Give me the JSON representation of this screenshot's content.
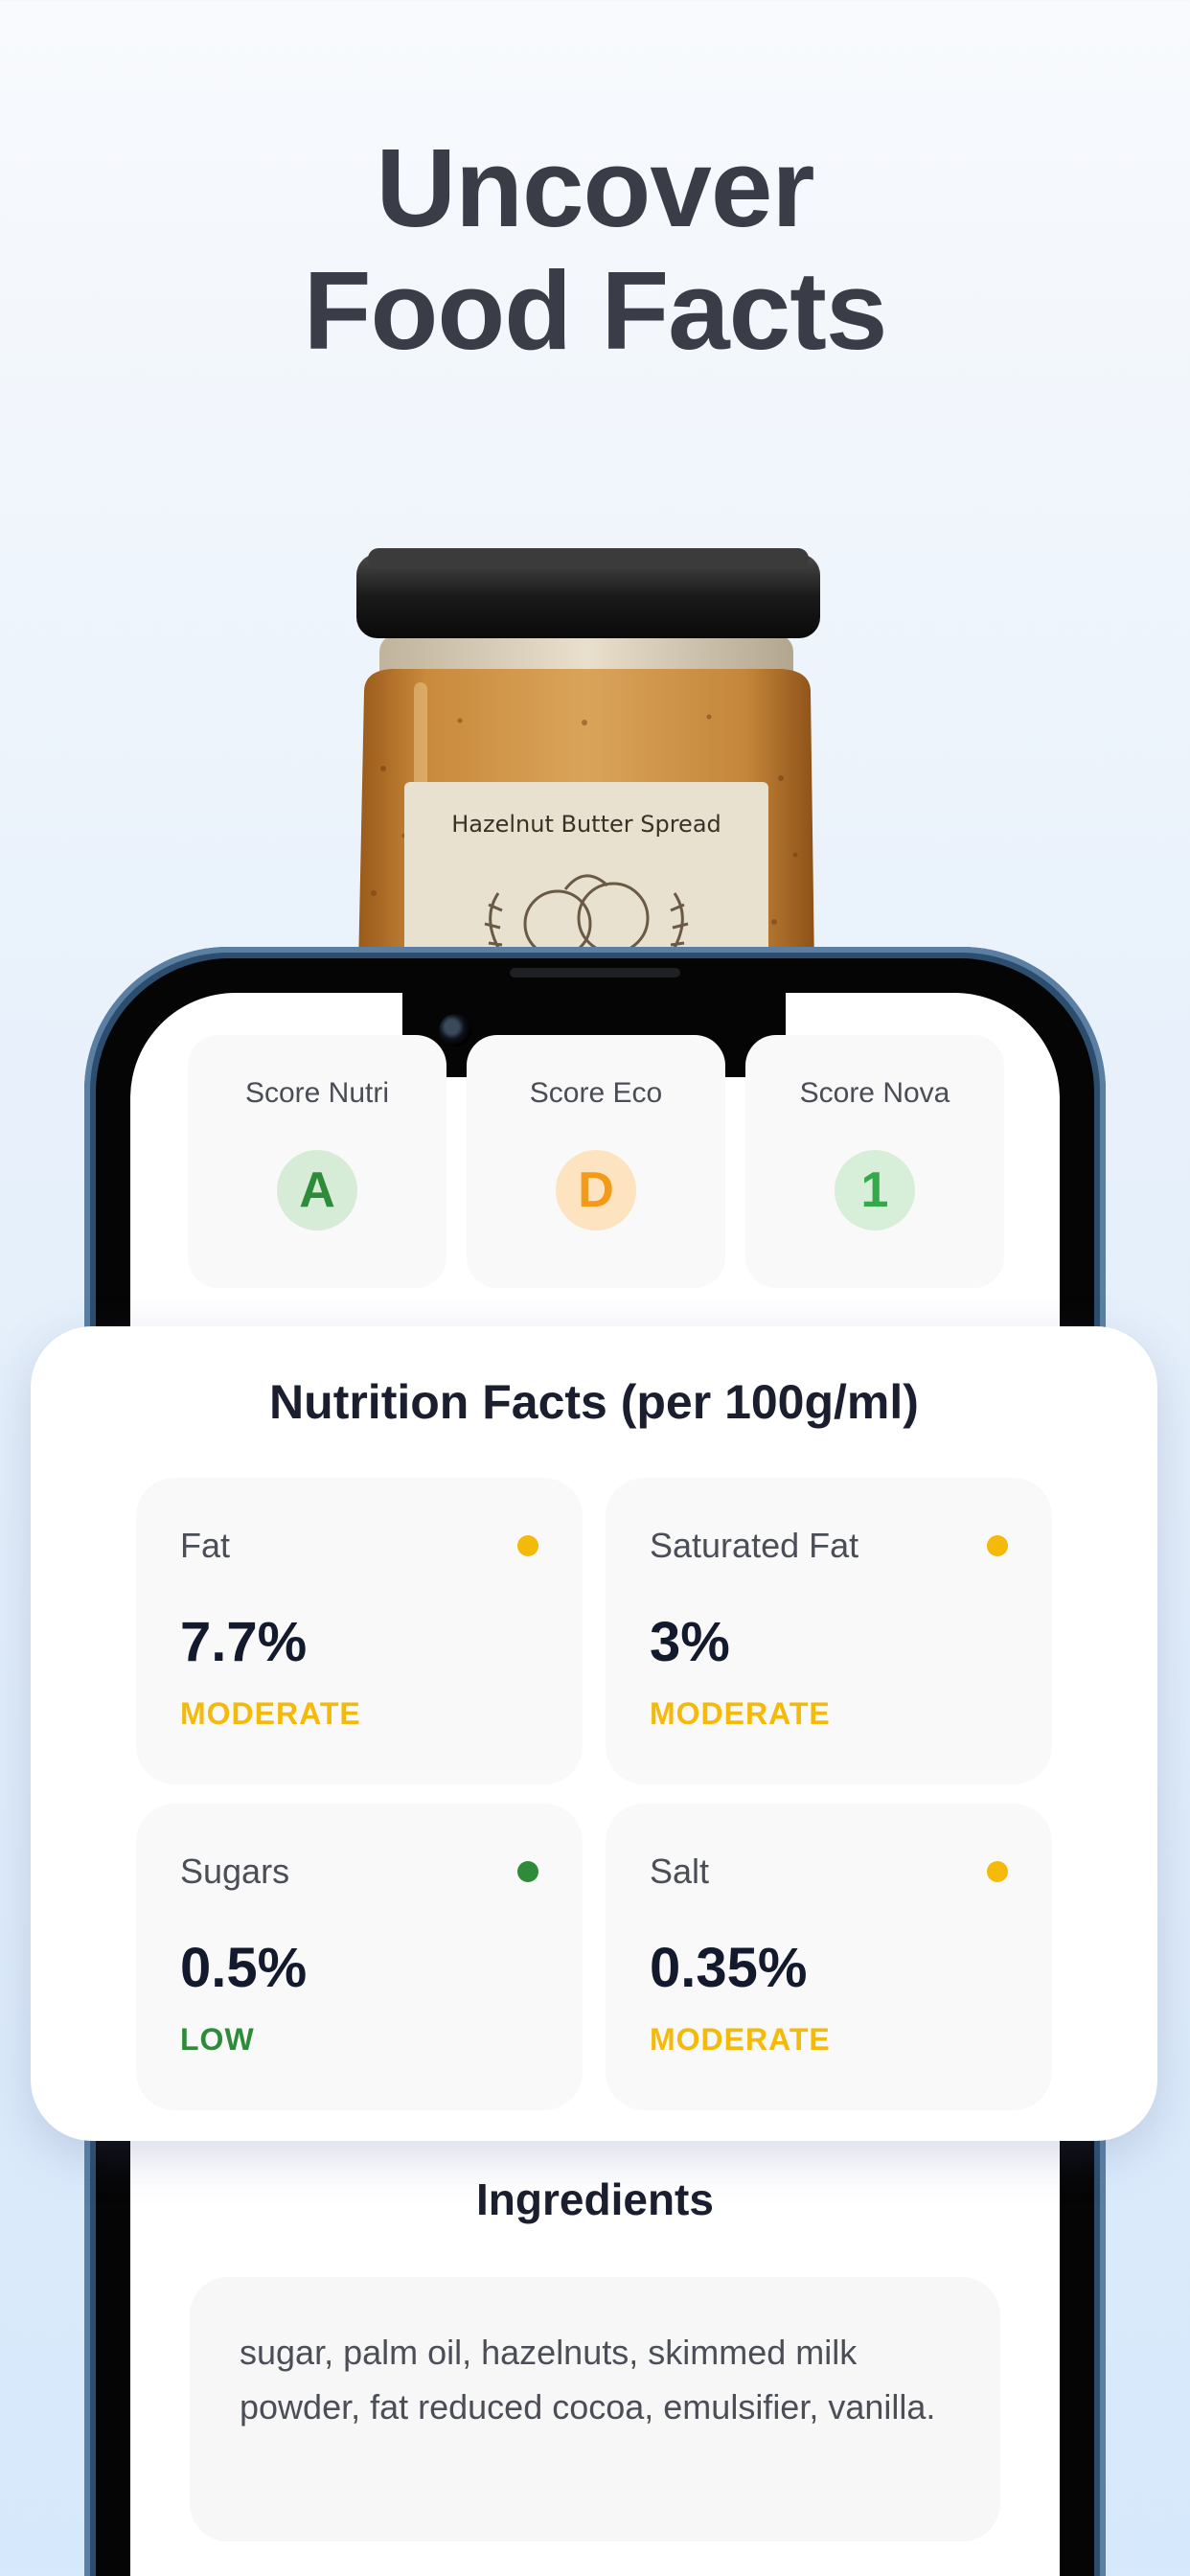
{
  "headline": {
    "line1": "Uncover",
    "line2": "Food Facts"
  },
  "product": {
    "label": "Hazelnut Butter Spread"
  },
  "scores": [
    {
      "title": "Score Nutri",
      "grade": "A",
      "color": "#2e8b3a",
      "bg": "#d7ecd6"
    },
    {
      "title": "Score Eco",
      "grade": "D",
      "color": "#f59a16",
      "bg": "#fde3c0"
    },
    {
      "title": "Score Nova",
      "grade": "1",
      "color": "#35a84a",
      "bg": "#d7efd9"
    }
  ],
  "nutrition": {
    "title": "Nutrition Facts (per 100g/ml)",
    "items": [
      {
        "label": "Fat",
        "value": "7.7%",
        "level": "MODERATE",
        "color": "#f5b90a"
      },
      {
        "label": "Saturated Fat",
        "value": "3%",
        "level": "MODERATE",
        "color": "#f5b90a"
      },
      {
        "label": "Sugars",
        "value": "0.5%",
        "level": "LOW",
        "color": "#2e8b3a"
      },
      {
        "label": "Salt",
        "value": "0.35%",
        "level": "MODERATE",
        "color": "#f5b90a"
      }
    ]
  },
  "ingredients": {
    "title": "Ingredients",
    "text": "sugar, palm oil, hazelnuts, skimmed milk powder, fat reduced cocoa, emulsifier, vanilla."
  }
}
